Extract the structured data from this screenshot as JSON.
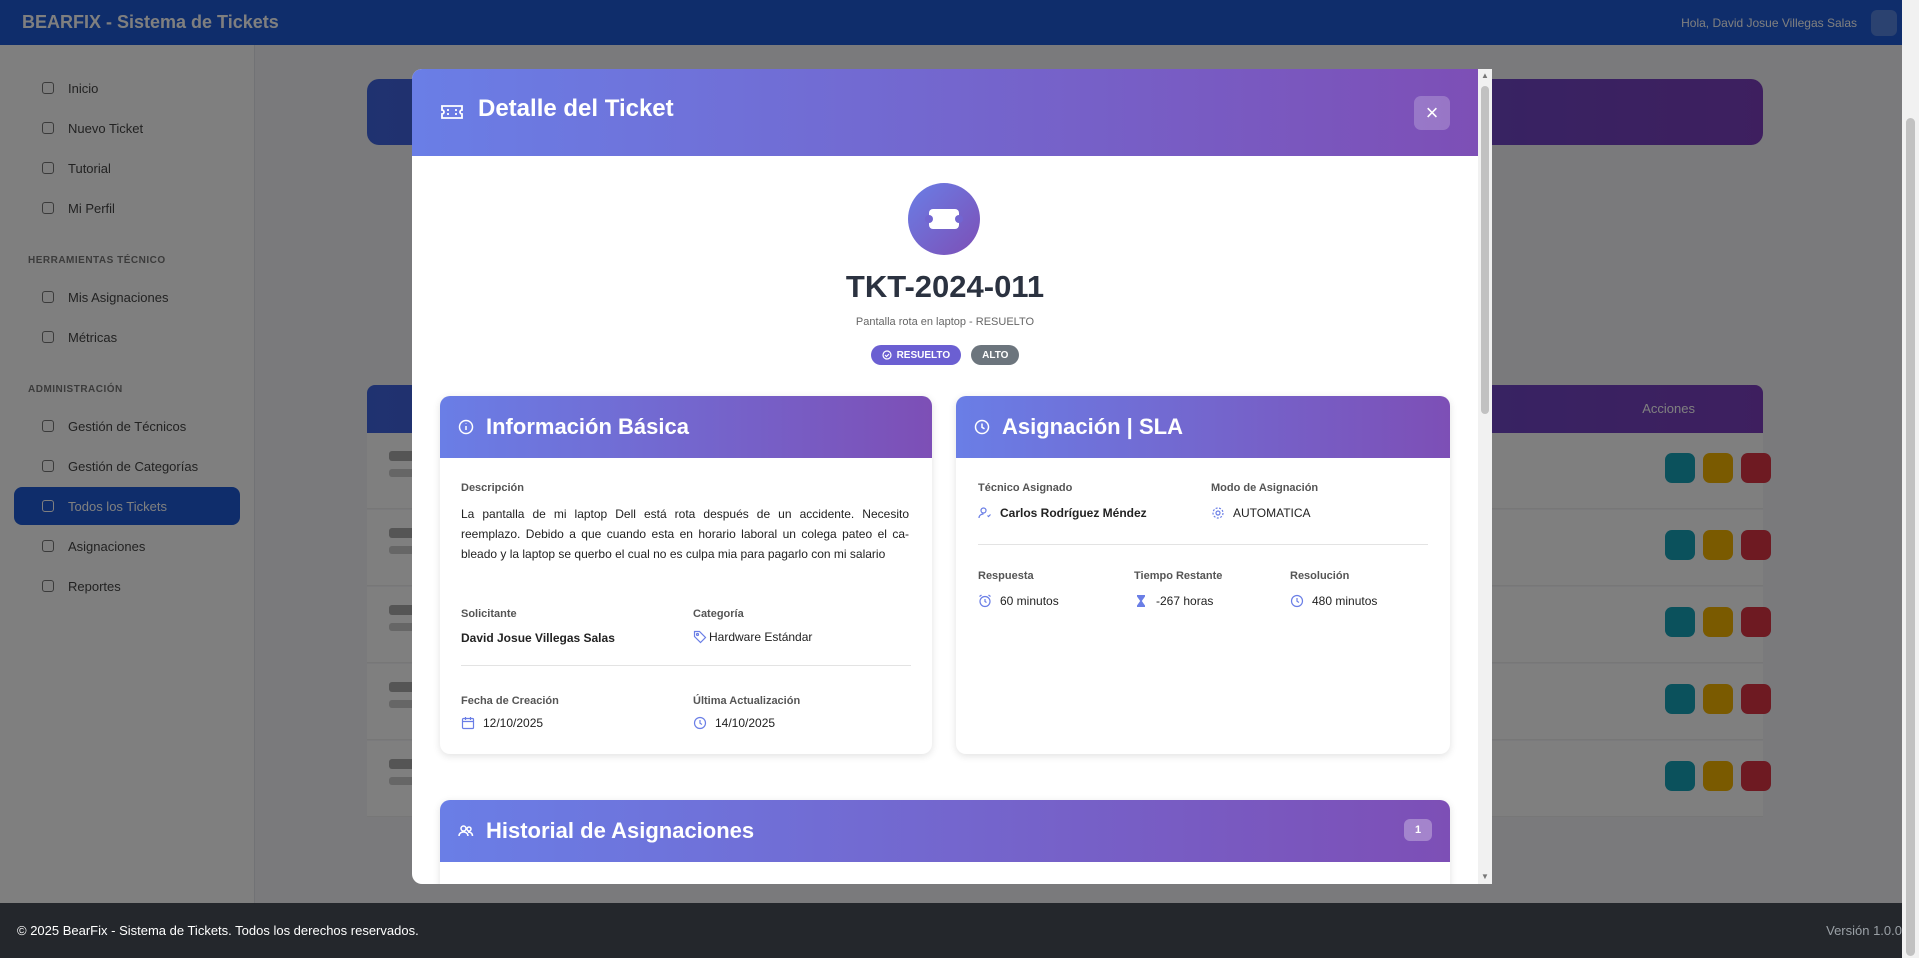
{
  "app": {
    "brand": "BEARFIX - Sistema de Tickets",
    "user": "Hola, David Josue Villegas Salas"
  },
  "sidebar": {
    "items_top": [
      "Inicio",
      "Nuevo Ticket",
      "Tutorial",
      "Mi Perfil"
    ],
    "section_tecnico": "HERRAMIENTAS TÉCNICO",
    "items_tecnico": [
      "Mis Asignaciones",
      "Métricas"
    ],
    "section_admin": "ADMINISTRACIÓN",
    "items_admin": [
      "Gestión de Técnicos",
      "Gestión de Categorías",
      "Todos los Tickets",
      "Asignaciones",
      "Reportes"
    ],
    "active_item": "Todos los Tickets"
  },
  "background_list": {
    "actions_header": "Acciones"
  },
  "modal": {
    "title": "Detalle del Ticket",
    "close_symbol": "×",
    "ticket_code": "TKT-2024-011",
    "subtitle": "Pantalla rota en laptop - RESUELTO",
    "status_badge": "RESUELTO",
    "priority_badge": "ALTO",
    "basic_info": {
      "title": "Información Básica",
      "description_label": "Descripción",
      "description": "La pantalla de mi laptop Dell está rota después de un accidente. Necesito reemplazo. Debido a que cuando esta en horario laboral un colega pateo el ca-bleado y la laptop se querbo el cual no es culpa mia para pagarlo con mi salario",
      "requester_label": "Solicitante",
      "requester": "David Josue Villegas Salas",
      "category_label": "Categoría",
      "category": "Hardware Estándar",
      "created_label": "Fecha de Creación",
      "created": "12/10/2025",
      "updated_label": "Última Actualización",
      "updated": "14/10/2025"
    },
    "assignment": {
      "title": "Asignación | SLA",
      "tech_label": "Técnico Asignado",
      "tech": "Carlos Rodríguez Méndez",
      "mode_label": "Modo de Asignación",
      "mode": "AUTOMATICA",
      "response_label": "Respuesta",
      "response": "60 minutos",
      "remaining_label": "Tiempo Restante",
      "remaining": "-267 horas",
      "resolution_label": "Resolución",
      "resolution": "480 minutos"
    },
    "history": {
      "title": "Historial de Asignaciones",
      "count": "1"
    }
  },
  "footer": {
    "copyright": "© 2025 BearFix - Sistema de Tickets. Todos los derechos reservados.",
    "version": "Versión 1.0.0"
  },
  "colors": {
    "primary": "#1f5bd6",
    "gradient_start": "#6a7ee6",
    "gradient_end": "#7d4fb6",
    "status": "#6b5fd2",
    "priority": "#6c757d"
  }
}
